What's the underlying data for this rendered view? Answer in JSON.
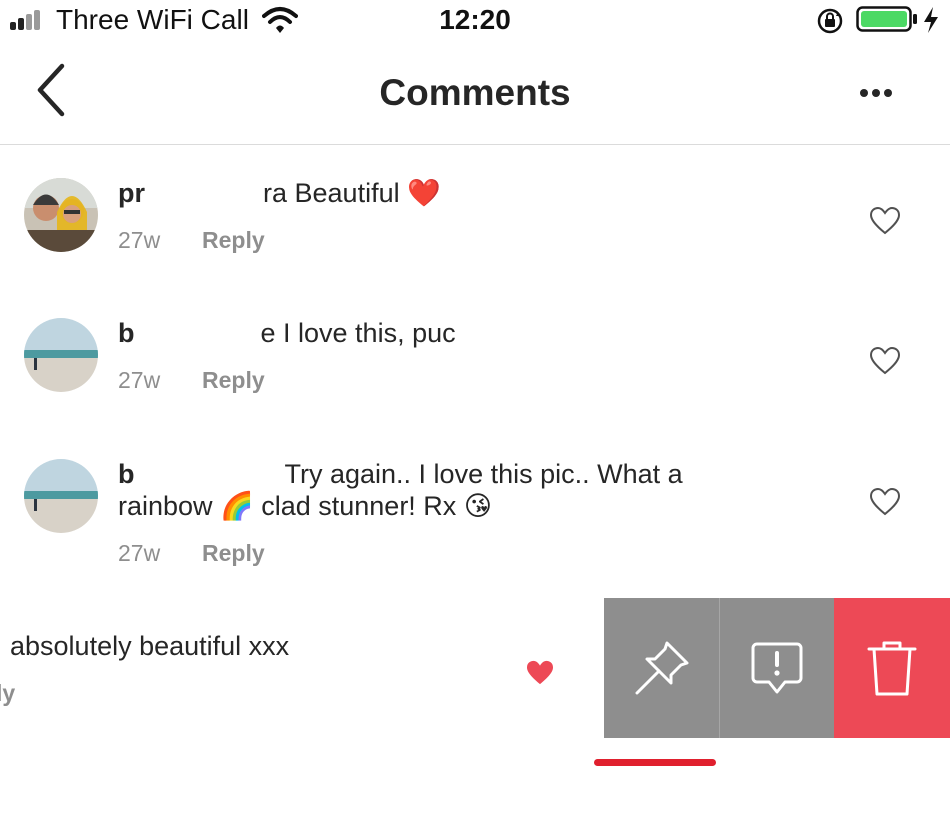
{
  "status_bar": {
    "carrier": "Three WiFi Call",
    "time": "12:20"
  },
  "nav": {
    "title": "Comments"
  },
  "comments": [
    {
      "username": "pr",
      "text": "ra Beautiful",
      "emoji": "❤️",
      "time": "27w",
      "reply": "Reply"
    },
    {
      "username": "b",
      "text": "e I love this, puc",
      "time": "27w",
      "reply": "Reply"
    },
    {
      "username": "b",
      "text": "Try again.. I love this pic.. What a",
      "text_line2_a": "rainbow",
      "emoji_a": "🌈",
      "text_line2_b": "clad stunner! Rx",
      "emoji_b": "😘",
      "time": "27w",
      "reply": "Reply"
    }
  ],
  "swiped_comment": {
    "text": "absolutely beautiful xxx",
    "reply_fragment": "ly",
    "liked": true
  },
  "actions": [
    "pin-icon",
    "report-icon",
    "trash-icon"
  ],
  "colors": {
    "accent_red": "#ed4956",
    "action_gray": "#8e8e8e",
    "indicator_red": "#e0202e"
  }
}
